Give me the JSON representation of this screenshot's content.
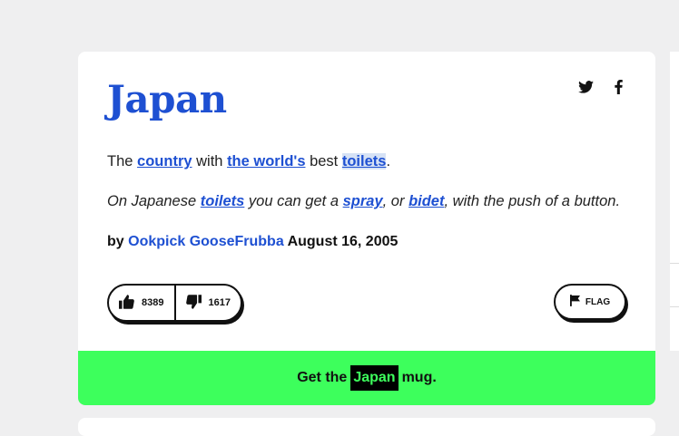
{
  "definition": {
    "word": "Japan",
    "meaning": {
      "t1": "The ",
      "l1": "country",
      "t2": " with ",
      "l2": "the world's",
      "t3": " best ",
      "l3": "toilets",
      "t4": "."
    },
    "example": {
      "t1": "On Japanese ",
      "l1": "toilets",
      "t2": " you can get a ",
      "l2": "spray",
      "t3": ", or ",
      "l3": "bidet",
      "t4": ", with the push of a button."
    },
    "author": {
      "by": "by ",
      "name": "Ookpick GooseFrubba",
      "date": " August 16, 2005"
    },
    "votes": {
      "up": "8389",
      "down": "1617"
    },
    "flag_label": "FLAG",
    "mug": {
      "pre": "Get the",
      "word": "Japan",
      "post": "mug."
    }
  },
  "share_icons": [
    "twitter-icon",
    "facebook-icon"
  ],
  "colors": {
    "link": "#1e50d2",
    "mug_bar": "#3dff5c",
    "background": "#efeff0"
  }
}
